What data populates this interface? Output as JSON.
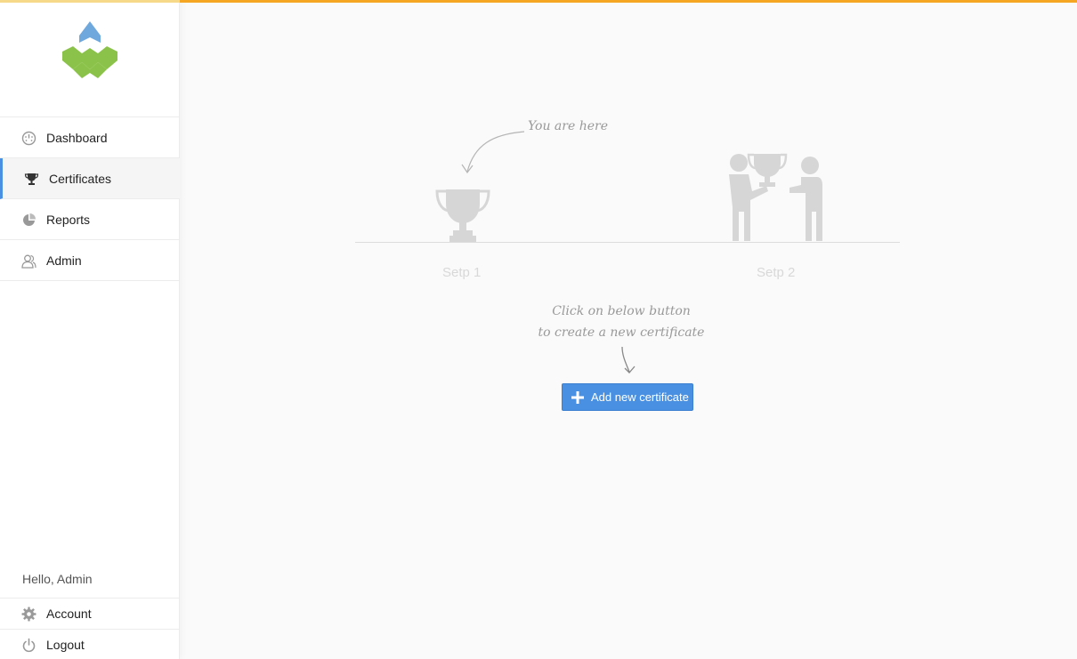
{
  "brand": {
    "accent": "#f5a623",
    "primary": "#4a90e2",
    "logo_top_color": "#6fa8dc",
    "logo_bottom_color": "#8bc34a"
  },
  "sidebar": {
    "items": [
      {
        "label": "Dashboard",
        "icon": "dashboard-gauge-icon",
        "active": false
      },
      {
        "label": "Certificates",
        "icon": "trophy-icon",
        "active": true
      },
      {
        "label": "Reports",
        "icon": "pie-chart-icon",
        "active": false
      },
      {
        "label": "Admin",
        "icon": "users-icon",
        "active": false
      }
    ],
    "greeting": "Hello, Admin",
    "bottom_items": [
      {
        "label": "Account",
        "icon": "gear-icon"
      },
      {
        "label": "Logout",
        "icon": "power-icon"
      }
    ]
  },
  "main": {
    "you_are_here": "You are here",
    "steps": [
      {
        "label": "Setp 1"
      },
      {
        "label": "Setp 2"
      }
    ],
    "instruction_line1": "Click on below button",
    "instruction_line2": "to create a new certificate",
    "add_button_label": "Add new certificate"
  }
}
